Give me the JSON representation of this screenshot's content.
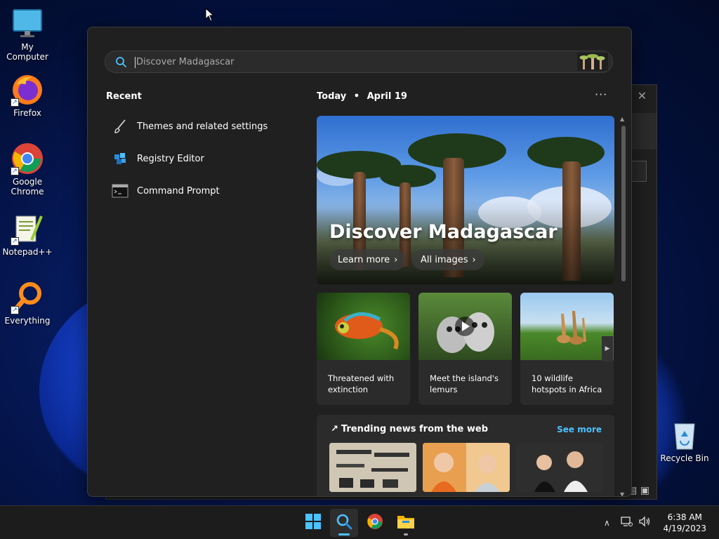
{
  "desktop": {
    "icons": [
      {
        "label": "My Computer",
        "icon": "monitor-icon"
      },
      {
        "label": "Firefox",
        "icon": "firefox-icon"
      },
      {
        "label": "Google Chrome",
        "icon": "chrome-icon"
      },
      {
        "label": "Notepad++",
        "icon": "notepadpp-icon"
      },
      {
        "label": "Everything",
        "icon": "everything-icon"
      },
      {
        "label": "Recycle Bin",
        "icon": "recycle-bin-icon"
      }
    ]
  },
  "search": {
    "placeholder": "Discover Madagascar"
  },
  "recent": {
    "title": "Recent",
    "items": [
      {
        "label": "Themes and related settings",
        "icon": "brush-icon"
      },
      {
        "label": "Registry Editor",
        "icon": "registry-icon"
      },
      {
        "label": "Command Prompt",
        "icon": "cmd-icon"
      }
    ]
  },
  "today": {
    "label": "Today",
    "separator": "•",
    "date": "April 19",
    "more": "···"
  },
  "hero": {
    "title": "Discover Madagascar",
    "learn_more": "Learn more",
    "all_images": "All images"
  },
  "cards": [
    {
      "caption": "Threatened with extinction",
      "icon": "chameleon-image"
    },
    {
      "caption": "Meet the island's lemurs",
      "icon": "lemur-image"
    },
    {
      "caption": "10 wildlife hotspots in Africa",
      "icon": "giraffe-image"
    }
  ],
  "trending": {
    "title": "Trending news from the web",
    "see_more": "See more"
  },
  "taskbar": {
    "time": "6:38 AM",
    "date": "4/19/2023",
    "apps": [
      "start-icon",
      "search-icon",
      "chrome-icon",
      "file-explorer-icon"
    ]
  },
  "colors": {
    "accent": "#4cc2ff",
    "panel": "#202020",
    "card": "#2b2b2b"
  }
}
